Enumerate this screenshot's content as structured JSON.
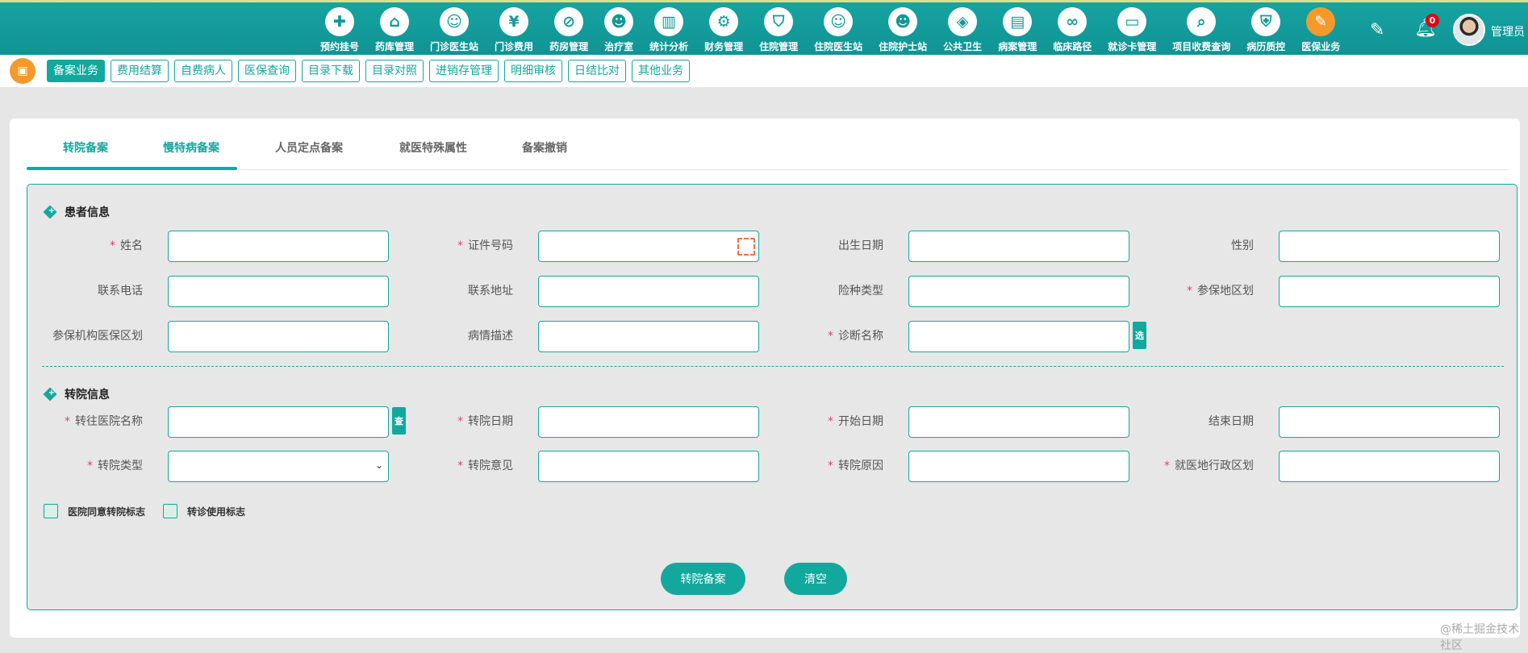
{
  "header": {
    "nav": [
      {
        "label": "预约挂号",
        "icon": "calendar-icon",
        "glyph": "✚"
      },
      {
        "label": "药库管理",
        "icon": "warehouse-icon",
        "glyph": "⌂"
      },
      {
        "label": "门诊医生站",
        "icon": "doctor-icon",
        "glyph": "☺"
      },
      {
        "label": "门诊费用",
        "icon": "yuan-icon",
        "glyph": "¥"
      },
      {
        "label": "药房管理",
        "icon": "pill-icon",
        "glyph": "⊘"
      },
      {
        "label": "治疗室",
        "icon": "nurse-icon",
        "glyph": "☻"
      },
      {
        "label": "统计分析",
        "icon": "chart-icon",
        "glyph": "▥"
      },
      {
        "label": "财务管理",
        "icon": "finance-icon",
        "glyph": "⚙"
      },
      {
        "label": "住院管理",
        "icon": "bed-icon",
        "glyph": "⛉"
      },
      {
        "label": "住院医生站",
        "icon": "inpatient-doctor-icon",
        "glyph": "☺"
      },
      {
        "label": "住院护士站",
        "icon": "inpatient-nurse-icon",
        "glyph": "☻"
      },
      {
        "label": "公共卫生",
        "icon": "public-health-icon",
        "glyph": "◈"
      },
      {
        "label": "病案管理",
        "icon": "medical-record-icon",
        "glyph": "▤"
      },
      {
        "label": "临床路径",
        "icon": "pathway-icon",
        "glyph": "∞"
      },
      {
        "label": "就诊卡管理",
        "icon": "card-icon",
        "glyph": "▭"
      },
      {
        "label": "项目收费查询",
        "icon": "fee-query-icon",
        "glyph": "⌕"
      },
      {
        "label": "病历质控",
        "icon": "quality-control-icon",
        "glyph": "⛨"
      },
      {
        "label": "医保业务",
        "icon": "insurance-icon",
        "glyph": "✎",
        "active": true
      }
    ],
    "notification_count": "0",
    "user": "管理员"
  },
  "subnav": [
    "备案业务",
    "费用结算",
    "自费病人",
    "医保查询",
    "目录下载",
    "目录对照",
    "进销存管理",
    "明细审核",
    "日结比对",
    "其他业务"
  ],
  "tabs": [
    "转院备案",
    "慢特病备案",
    "人员定点备案",
    "就医特殊属性",
    "备案撤销"
  ],
  "sections": {
    "patient": {
      "title": "患者信息",
      "rows": [
        [
          {
            "label": "姓名",
            "req": true
          },
          {
            "label": "证件号码",
            "req": true,
            "scan": true
          },
          {
            "label": "出生日期"
          },
          {
            "label": "性别"
          }
        ],
        [
          {
            "label": "联系电话"
          },
          {
            "label": "联系地址"
          },
          {
            "label": "险种类型"
          },
          {
            "label": "参保地区划",
            "req": true
          }
        ],
        [
          {
            "label": "参保机构医保区划"
          },
          {
            "label": "病情描述"
          },
          {
            "label": "诊断名称",
            "req": true,
            "btn": "选"
          }
        ]
      ]
    },
    "transfer": {
      "title": "转院信息",
      "rows": [
        [
          {
            "label": "转往医院名称",
            "req": true,
            "btn": "查"
          },
          {
            "label": "转院日期",
            "req": true
          },
          {
            "label": "开始日期",
            "req": true
          },
          {
            "label": "结束日期"
          }
        ],
        [
          {
            "label": "转院类型",
            "req": true,
            "select": true
          },
          {
            "label": "转院意见",
            "req": true
          },
          {
            "label": "转院原因",
            "req": true
          },
          {
            "label": "就医地行政区划",
            "req": true
          }
        ]
      ]
    }
  },
  "checkboxes": [
    "医院同意转院标志",
    "转诊使用标志"
  ],
  "buttons": {
    "submit": "转院备案",
    "clear": "清空"
  },
  "watermark": "@稀土掘金技术社区",
  "colors": {
    "accent": "#13a89e",
    "required": "#e04070",
    "orange": "#f39a2b"
  }
}
